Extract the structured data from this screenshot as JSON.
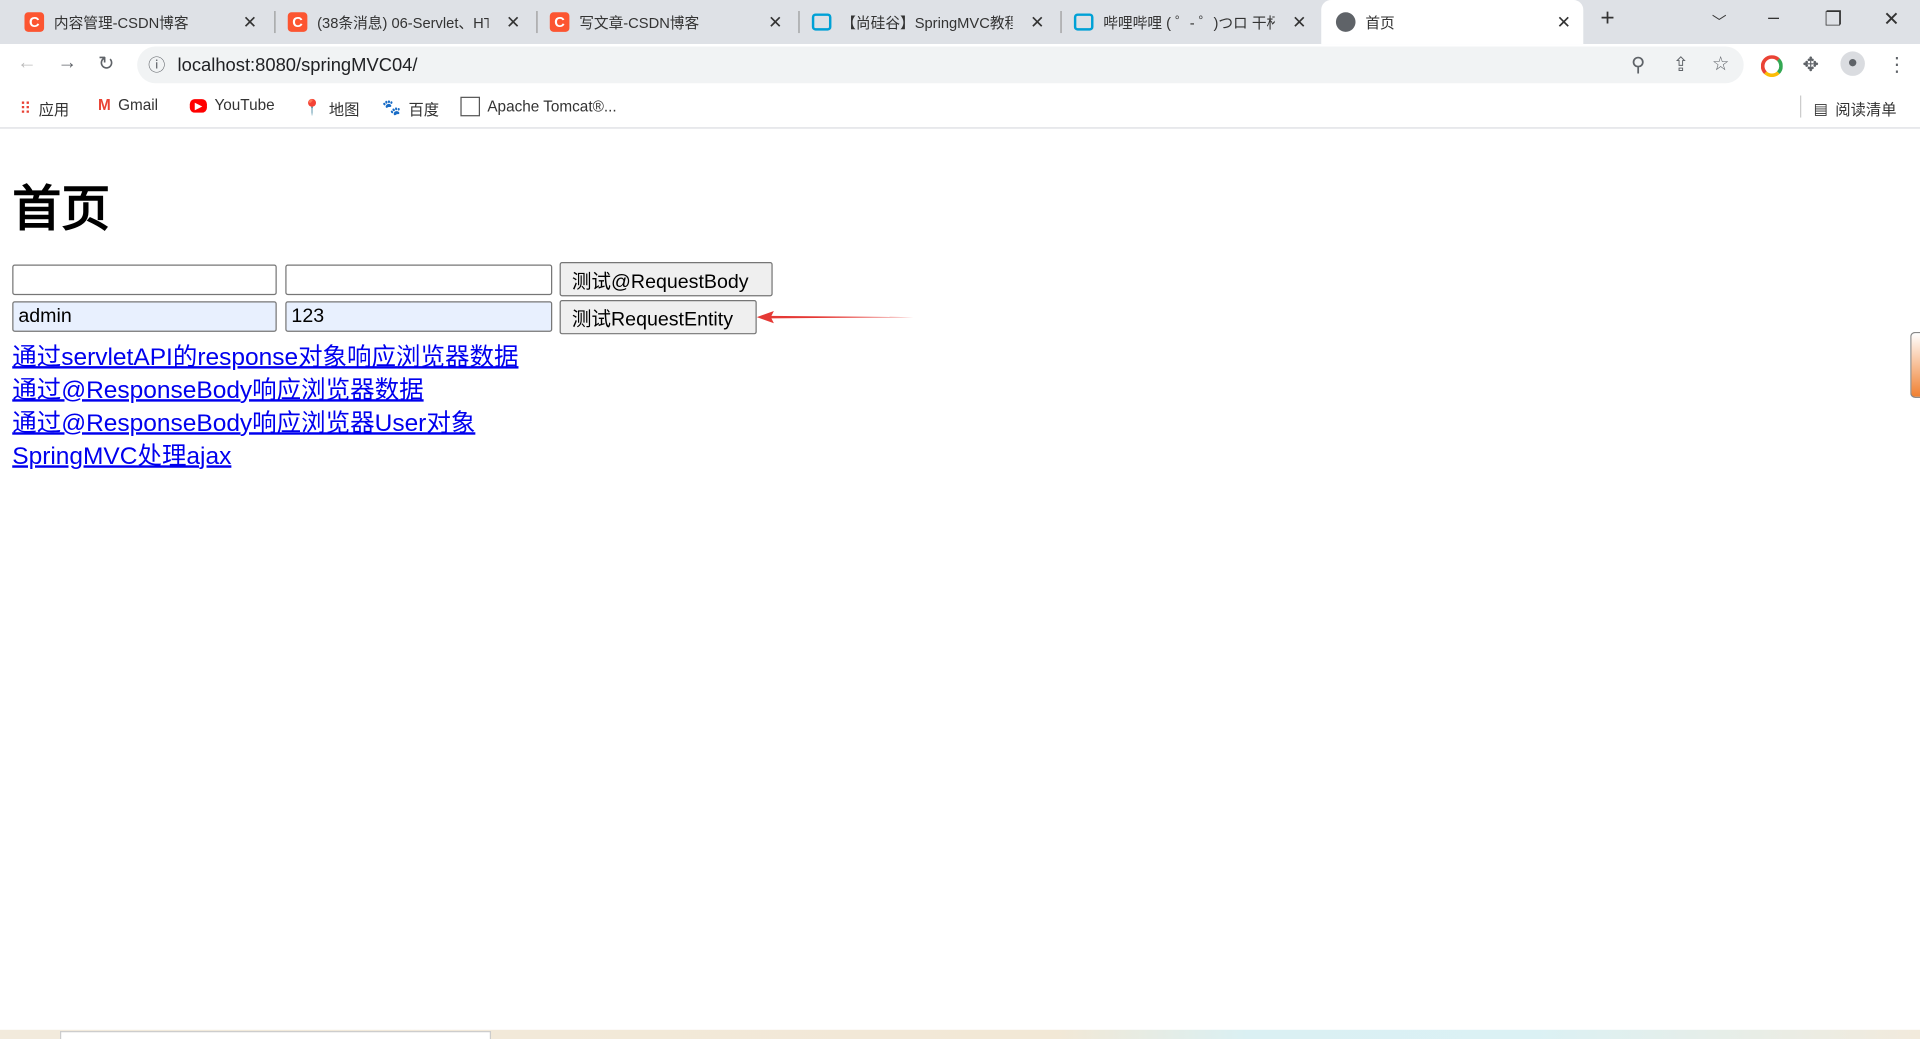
{
  "browser": {
    "tabs": [
      {
        "title": "内容管理-CSDN博客",
        "icon": "csdn-icon",
        "color": "#fc5531"
      },
      {
        "title": "(38条消息) 06-Servlet、HT",
        "icon": "csdn-icon",
        "color": "#fc5531"
      },
      {
        "title": "写文章-CSDN博客",
        "icon": "csdn-icon",
        "color": "#fc5531"
      },
      {
        "title": "【尚硅谷】SpringMVC教程",
        "icon": "bilibili-icon",
        "color": "#00a1d6"
      },
      {
        "title": "哔哩哔哩 ( ゜- ゜)つロ 干杯",
        "icon": "bilibili-icon",
        "color": "#00a1d6"
      },
      {
        "title": "首页",
        "icon": "globe-icon",
        "color": "#5f6368"
      }
    ],
    "url": "localhost:8080/springMVC04/",
    "bookmarks": [
      "应用",
      "Gmail",
      "YouTube",
      "地图",
      "百度",
      "Apache Tomcat®..."
    ],
    "reading_list": "阅读清单"
  },
  "page": {
    "heading": "首页",
    "form1": {
      "username": "",
      "password": "",
      "button": "测试@RequestBody"
    },
    "form2": {
      "username": "admin",
      "password": "123",
      "button": "测试RequestEntity"
    },
    "links": [
      "通过servletAPI的response对象响应浏览器数据",
      "通过@ResponseBody响应浏览器数据",
      "通过@ResponseBody响应浏览器User对象",
      "SpringMVC处理ajax"
    ]
  },
  "colors": {
    "link": "#0000ee",
    "annotation_arrow": "#e53935",
    "autofill": "#e8f0fe"
  }
}
